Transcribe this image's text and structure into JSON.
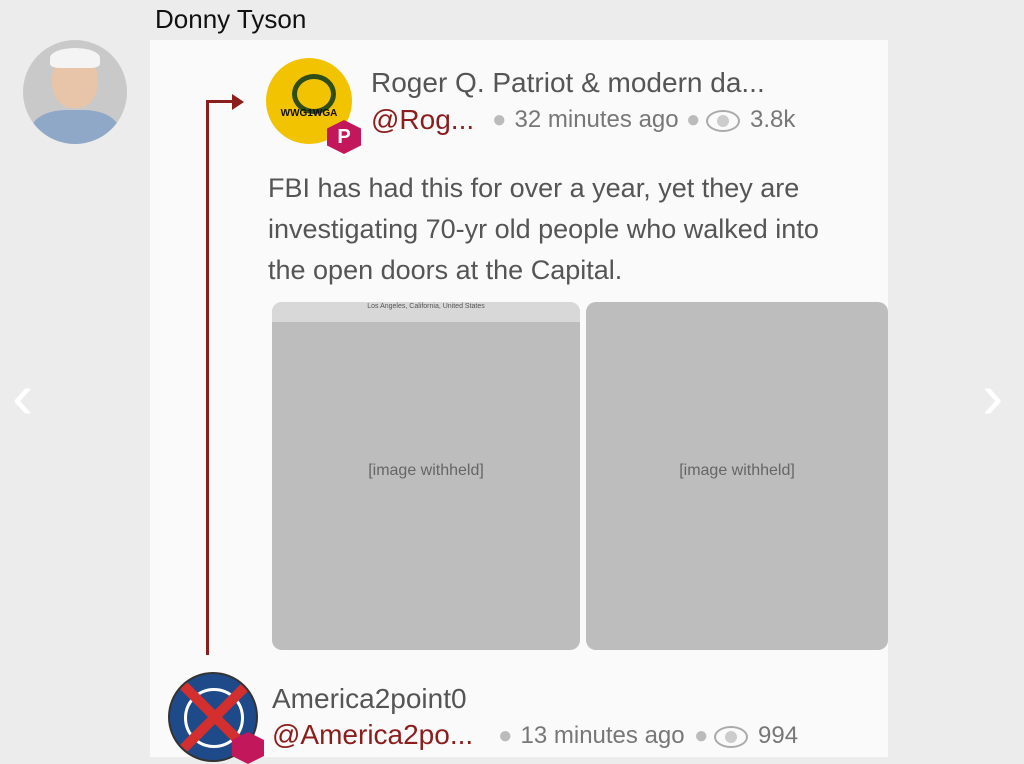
{
  "facebook_post": {
    "poster_name": "Donny Tyson",
    "nav_prev": "‹",
    "nav_next": "›"
  },
  "screenshot": {
    "post1": {
      "author_name": "Roger Q. Patriot & modern da...",
      "author_handle": "@Rog...",
      "time": "32 minutes ago",
      "views": "3.8k",
      "avatar_text": "WWG1WGA",
      "text": "FBI has had this for over a year, yet they are investigating 70-yr old people who walked into the open doors at the Capital.",
      "image1_caption": "Los Angeles, California, United States",
      "image_placeholder": "[image withheld]"
    },
    "post2": {
      "author_name": "America2point0",
      "author_handle": "@America2po...",
      "time": "13 minutes ago",
      "views": "994"
    }
  },
  "colors": {
    "thread_line": "#8b1d1d",
    "handle": "#8b1d1d",
    "parler_badge": "#c2185b"
  }
}
